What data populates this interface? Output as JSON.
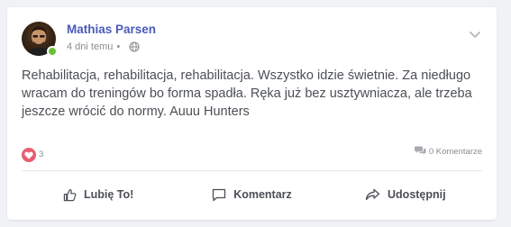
{
  "post": {
    "author": "Mathias Parsen",
    "time_ago": "4 dni temu",
    "separator": "•",
    "privacy_icon": "globe-icon",
    "text": "Rehabilitacja, rehabilitacja, rehabilitacja. Wszystko idzie świetnie. Za niedługo wracam do treningów bo forma spadła. Ręka już bez usztywniacza, ale trzeba jeszcze wrócić do normy. Auuu Hunters",
    "reactions": {
      "icon": "heart-icon",
      "count": "3"
    },
    "comments": {
      "icon": "comment-bubbles-icon",
      "label": "0 Komentarze"
    },
    "menu_icon": "chevron-down-icon"
  },
  "actions": {
    "like": {
      "label": "Lubię To!",
      "icon": "thumbs-up-icon"
    },
    "comment": {
      "label": "Komentarz",
      "icon": "comment-icon"
    },
    "share": {
      "label": "Udostępnij",
      "icon": "share-icon"
    }
  },
  "colors": {
    "author": "#4a5ab8",
    "online": "#6bbf3a",
    "heart": "#ea5d72",
    "text": "#4b4f56",
    "muted": "#8a8d91",
    "background": "#f0f2f5"
  }
}
